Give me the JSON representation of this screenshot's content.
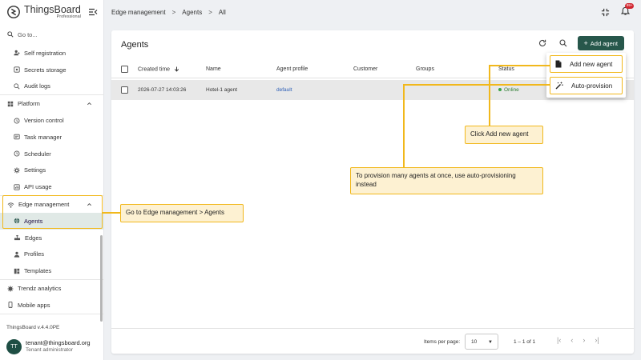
{
  "app": {
    "brand": "ThingsBoard",
    "edition": "Professional",
    "version": "ThingsBoard v.4.4.0PE"
  },
  "search": {
    "placeholder": "Go to..."
  },
  "sidebar": {
    "items": [
      {
        "label": "Self registration",
        "icon": "self-registration-icon"
      },
      {
        "label": "Secrets storage",
        "icon": "secrets-icon"
      },
      {
        "label": "Audit logs",
        "icon": "audit-icon"
      },
      {
        "label": "Platform",
        "icon": "platform-icon"
      },
      {
        "label": "Version control",
        "icon": "history-icon"
      },
      {
        "label": "Task manager",
        "icon": "task-icon"
      },
      {
        "label": "Scheduler",
        "icon": "clock-icon"
      },
      {
        "label": "Settings",
        "icon": "gear-icon"
      },
      {
        "label": "API usage",
        "icon": "api-icon"
      },
      {
        "label": "Edge management",
        "icon": "edge-icon"
      },
      {
        "label": "Agents",
        "icon": "agent-icon"
      },
      {
        "label": "Edges",
        "icon": "edges-icon"
      },
      {
        "label": "Profiles",
        "icon": "profile-icon"
      },
      {
        "label": "Templates",
        "icon": "templates-icon"
      },
      {
        "label": "Trendz analytics",
        "icon": "trendz-icon"
      },
      {
        "label": "Mobile apps",
        "icon": "mobile-icon"
      }
    ]
  },
  "user": {
    "initials": "TT",
    "email": "tenant@thingsboard.org",
    "role": "Tenant administrator"
  },
  "breadcrumb": [
    "Edge management",
    "Agents",
    "All"
  ],
  "notifications": {
    "count": "99+"
  },
  "page": {
    "title": "Agents",
    "add_label": "Add agent"
  },
  "table": {
    "columns": [
      "Created time",
      "Name",
      "Agent profile",
      "Customer",
      "Groups",
      "Status"
    ],
    "rows": [
      {
        "created": "2026-07-27 14:03:26",
        "name": "Hotel-1 agent",
        "profile": "default",
        "customer": "",
        "groups": "",
        "status": "Online"
      }
    ]
  },
  "pagination": {
    "items_per_page_label": "Items per page:",
    "items_per_page": "10",
    "range": "1 – 1 of 1"
  },
  "menu": {
    "add_new": "Add new agent",
    "auto_provision": "Auto-provision"
  },
  "callouts": {
    "nav": "Go to Edge management > Agents",
    "add": "Click Add new agent",
    "provision": "To provision many agents at once, use auto-provisioning instead"
  },
  "colors": {
    "accent": "#27574b",
    "highlight": "#f1b81c",
    "callout_bg": "#fdf1d2",
    "online": "#2f7d32",
    "link": "#2b5db6"
  }
}
